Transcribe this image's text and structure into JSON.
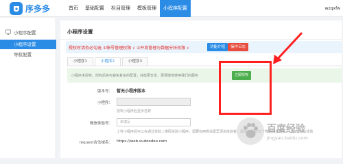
{
  "header": {
    "logo_text": "序多多",
    "nav": [
      "首页",
      "基础配置",
      "栏目管理",
      "模板管理",
      "小程序配置"
    ],
    "active_nav": 4,
    "user": "wzqxfw"
  },
  "sidebar": {
    "section_title": "小程序配置",
    "items": [
      {
        "label": "小程序设置",
        "active": true
      },
      {
        "label": "导航配置",
        "active": false
      }
    ]
  },
  "main": {
    "title": "小程序设置",
    "notice": {
      "text": "授权时请务必勾选 ①帐号管理权限 √ ②开发管理与数据分析权限 √",
      "btn_intro": "功能介绍",
      "btn_log": "操作日志"
    },
    "tabs": [
      "小程序1",
      "小程序2",
      "小程序3"
    ],
    "active_tab": 1,
    "auth": {
      "text": "小程序未授权，授权后将可避免复杂的配置，并能更安全、更便捷地使用我们的服务",
      "button": "立即授权"
    },
    "form": {
      "version_label": "版本号：",
      "version_value": "暂无小程序版本",
      "mp_label": "小程序：",
      "mp_hint": "授权小程序后显示名称",
      "wx_label": "微信体验号：",
      "wx_placeholder": "未填写",
      "wx_hint": "上传小程序后可以先通过体验二维码体验小程序，需要在两微设置里添加体验者，最多可添加30个微信体验用户，让他们可以体验",
      "domain_label": "request合法域名：",
      "domain_value": "https://web.xudoodoo.com"
    }
  },
  "colors": {
    "brand": "#2b8ce6",
    "annotation": "#ff1f1f",
    "auth_button": "#4cae4c",
    "notice_text": "#e02d2d",
    "btn_intro": "#2b8ce6",
    "btn_log": "#e74c3c"
  },
  "watermark": {
    "main": "百度经验",
    "sub": "jingyan.baidu.com",
    "icon": "baidu-paw-icon"
  }
}
